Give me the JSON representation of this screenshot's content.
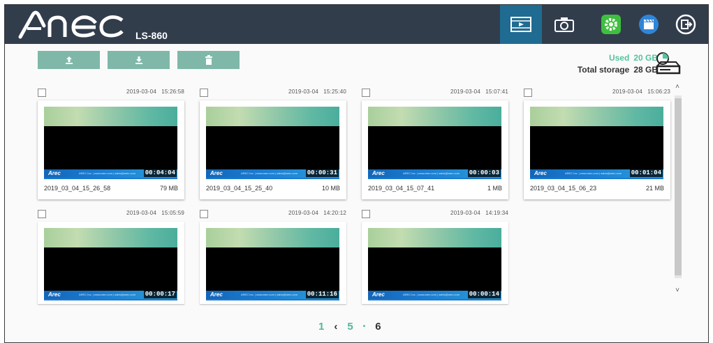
{
  "header": {
    "brand": "AREC",
    "model": "LS-860",
    "nav": [
      {
        "name": "recordings",
        "icon": "film-play-icon",
        "active": true
      },
      {
        "name": "snapshots",
        "icon": "camera-icon",
        "active": false
      },
      {
        "name": "settings",
        "icon": "gear-icon",
        "active": false
      },
      {
        "name": "media",
        "icon": "clapperboard-icon",
        "active": false
      },
      {
        "name": "logout",
        "icon": "exit-icon",
        "active": false
      }
    ]
  },
  "toolbar": {
    "upload": {
      "icon": "upload-icon"
    },
    "download": {
      "icon": "download-icon"
    },
    "delete": {
      "icon": "trash-icon"
    }
  },
  "storage": {
    "used_label": "Used",
    "used_value": "20 GB",
    "total_label": "Total storage",
    "total_value": "28 GB"
  },
  "files": [
    {
      "date": "2019-03-04",
      "time": "15:26:58",
      "name": "2019_03_04_15_26_58",
      "size": "79 MB",
      "duration": "00:04:04"
    },
    {
      "date": "2019-03-04",
      "time": "15:25:40",
      "name": "2019_03_04_15_25_40",
      "size": "10 MB",
      "duration": "00:00:31"
    },
    {
      "date": "2019-03-04",
      "time": "15:07:41",
      "name": "2019_03_04_15_07_41",
      "size": "1 MB",
      "duration": "00:00:03"
    },
    {
      "date": "2019-03-04",
      "time": "15:06:23",
      "name": "2019_03_04_15_06_23",
      "size": "21 MB",
      "duration": "00:01:04"
    },
    {
      "date": "2019-03-04",
      "time": "15:05:59",
      "name": "",
      "size": "",
      "duration": "00:00:17"
    },
    {
      "date": "2019-03-04",
      "time": "14:20:12",
      "name": "",
      "size": "",
      "duration": "00:11:16"
    },
    {
      "date": "2019-03-04",
      "time": "14:19:34",
      "name": "",
      "size": "",
      "duration": "00:00:14"
    }
  ],
  "thumb_overlay": {
    "logo": "Arec",
    "ticker": "AREC Inc. | www.arec.com | sales@arec.com"
  },
  "pagination": {
    "first": "1",
    "prev": "‹",
    "current_prev": "5",
    "separator": "•",
    "current": "6"
  },
  "scroll": {
    "up": "˄",
    "down": "˅"
  }
}
